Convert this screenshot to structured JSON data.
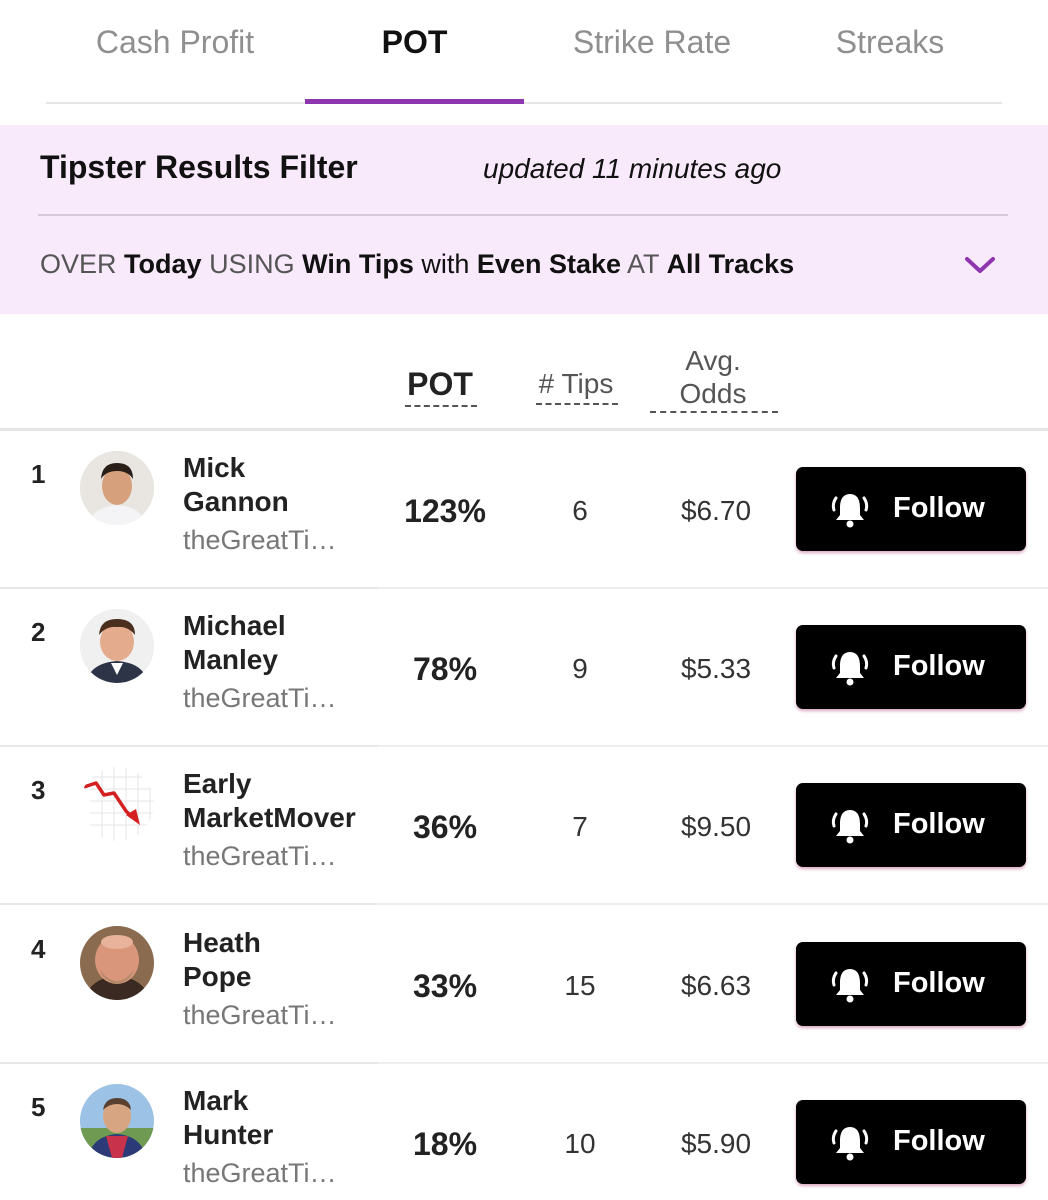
{
  "tabs": [
    {
      "label": "Cash Profit",
      "active": false
    },
    {
      "label": "POT",
      "active": true
    },
    {
      "label": "Strike Rate",
      "active": false
    },
    {
      "label": "Streaks",
      "active": false
    }
  ],
  "accent_color": "#8e35b0",
  "filter": {
    "title": "Tipster Results Filter",
    "updated": "updated 11 minutes ago",
    "over_label": "OVER",
    "over_value": "Today",
    "using_label": "USING",
    "using_value": "Win Tips",
    "with_label": "with",
    "with_value": "Even Stake",
    "at_label": "AT",
    "at_value": "All Tracks",
    "expand_icon": "chevron-down-icon",
    "background": "#f8e9fb"
  },
  "columns": {
    "pot": "POT",
    "tips": "# Tips",
    "odds_line1": "Avg.",
    "odds_line2": "Odds"
  },
  "tipsters": [
    {
      "rank": "1",
      "first": "Mick",
      "last": "Gannon",
      "source": "theGreatTi…",
      "pot": "123%",
      "tips": "6",
      "odds": "$6.70",
      "follow": "Follow",
      "avatar": "photo-avatar"
    },
    {
      "rank": "2",
      "first": "Michael",
      "last": "Manley",
      "source": "theGreatTi…",
      "pot": "78%",
      "tips": "9",
      "odds": "$5.33",
      "follow": "Follow",
      "avatar": "photo-avatar"
    },
    {
      "rank": "3",
      "first": "Early",
      "last": "MarketMover",
      "source": "theGreatTi…",
      "pot": "36%",
      "tips": "7",
      "odds": "$9.50",
      "follow": "Follow",
      "avatar": "falling-chart-icon"
    },
    {
      "rank": "4",
      "first": "Heath",
      "last": "Pope",
      "source": "theGreatTi…",
      "pot": "33%",
      "tips": "15",
      "odds": "$6.63",
      "follow": "Follow",
      "avatar": "photo-avatar"
    },
    {
      "rank": "5",
      "first": "Mark",
      "last": "Hunter",
      "source": "theGreatTi…",
      "pot": "18%",
      "tips": "10",
      "odds": "$5.90",
      "follow": "Follow",
      "avatar": "photo-avatar"
    }
  ]
}
